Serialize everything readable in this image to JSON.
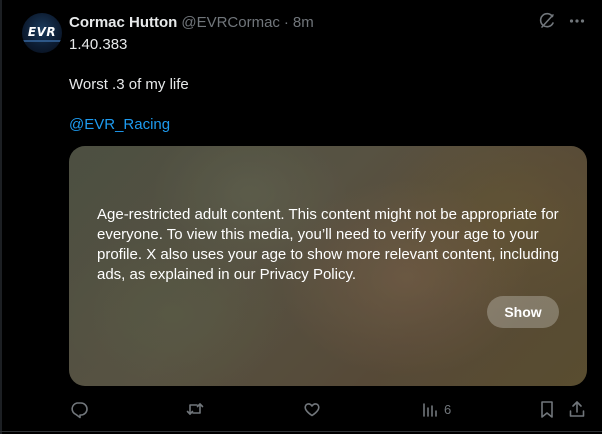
{
  "tweet": {
    "author": {
      "display_name": "Cormac Hutton",
      "handle": "@EVRCormac",
      "separator": "·",
      "time": "8m",
      "avatar_logo_text": "EVR"
    },
    "lines": [
      "1.40.383",
      "Worst .3 of my life"
    ],
    "mention": "@EVR_Racing",
    "media": {
      "warning_text": "Age-restricted adult content. This content might not be appropriate for everyone. To view this media, you’ll need to verify your age to your profile. X also uses your age to show more relevant content, including ads, as explained in our Privacy Policy.",
      "show_label": "Show"
    },
    "actions": {
      "reply_icon": "reply-icon",
      "repost_icon": "repost-icon",
      "like_icon": "like-icon",
      "views_icon": "views-icon",
      "views_count": "6",
      "bookmark_icon": "bookmark-icon",
      "share_icon": "share-icon"
    },
    "top_icons": [
      "grok-icon",
      "more-icon"
    ]
  },
  "colors": {
    "background": "#000000",
    "text": "#e7e9ea",
    "muted": "#71767b",
    "accent": "#1d9bf0"
  }
}
